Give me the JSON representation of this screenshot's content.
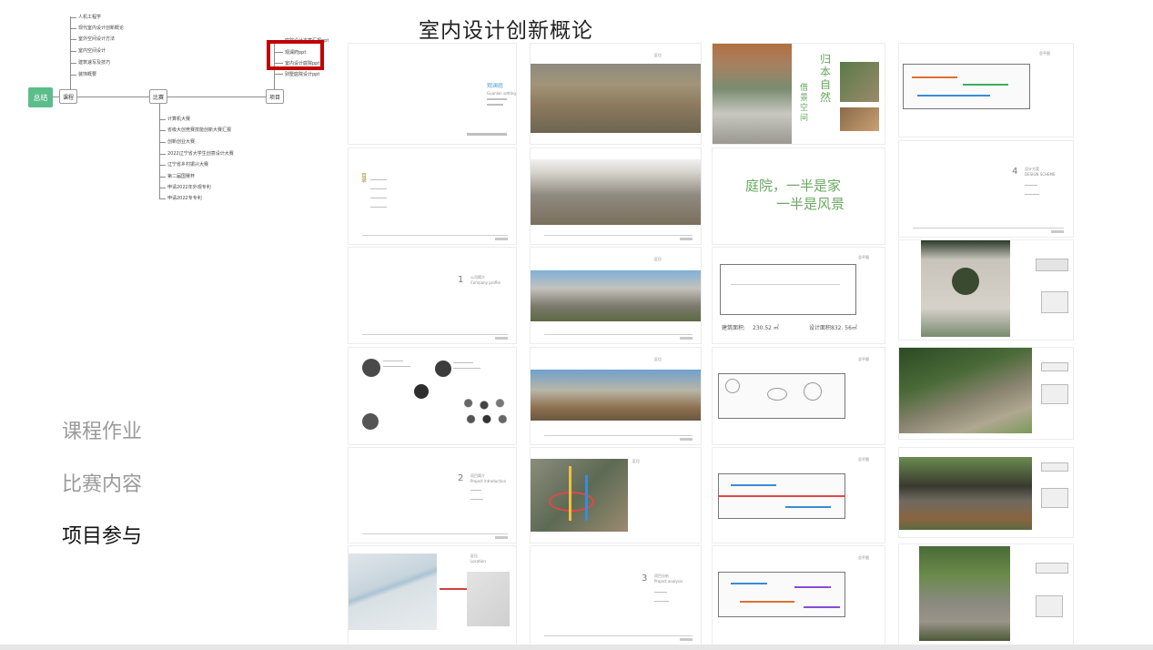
{
  "title": "室内设计创新概论",
  "mindmap": {
    "root": "总结",
    "branches": [
      "课程",
      "比赛",
      "项目"
    ],
    "course_items": [
      "人机工程学",
      "现代室内设计创新概论",
      "室外空间设计方法",
      "室内空间设计",
      "建筑速写及技巧",
      "装饰概要"
    ],
    "competition_items": [
      "计算机大赛",
      "省级大创竞赛技能创新大赛汇报",
      "创新创业大赛",
      "2022辽宁省大学生创意设计大赛",
      "辽宁省乡村振兴大赛",
      "第二届国赛杯",
      "申请2022年外观专利",
      "申请2022专专利"
    ],
    "project_items": [
      "庭院设计方案汇报ppt",
      "观澜府ppt",
      "室内设计庭院ppt",
      "别墅庭院设计ppt"
    ]
  },
  "menu": {
    "item1": "课程作业",
    "item2": "比赛内容",
    "item3": "项目参与"
  },
  "thumbs": {
    "cover_title": "观澜庭",
    "cover_sub": "Guanlan setting",
    "toc_title": "目录",
    "toc_label": "目\n录",
    "section1_num": "1",
    "section1_title": "公司简介",
    "section1_en": "Company profile",
    "section2_num": "2",
    "section2_title": "项目简介",
    "section2_en": "Project introduction",
    "section3_num": "3",
    "section3_title": "项目分析",
    "section3_en": "Project analysis",
    "section4_num": "4",
    "section4_title": "设计方案",
    "section4_en": "DESIGN SCHEME",
    "location_label": "区位",
    "location_en": "Location",
    "vert_text1": "归本自然",
    "vert_text2": "借景空间",
    "quote_line1": "庭院，一半是家",
    "quote_line2": "一半是风景",
    "area_label": "建筑面积:",
    "area_value": "230.52 ㎡",
    "design_area": "设计面积832. 56㎡",
    "plan_label": "总平图"
  },
  "colors": {
    "accent_green": "#5bbd8a",
    "highlight_red": "#c00000",
    "menu_inactive": "#9a9a9a",
    "menu_active": "#111111",
    "quote_green": "#6aa860"
  }
}
